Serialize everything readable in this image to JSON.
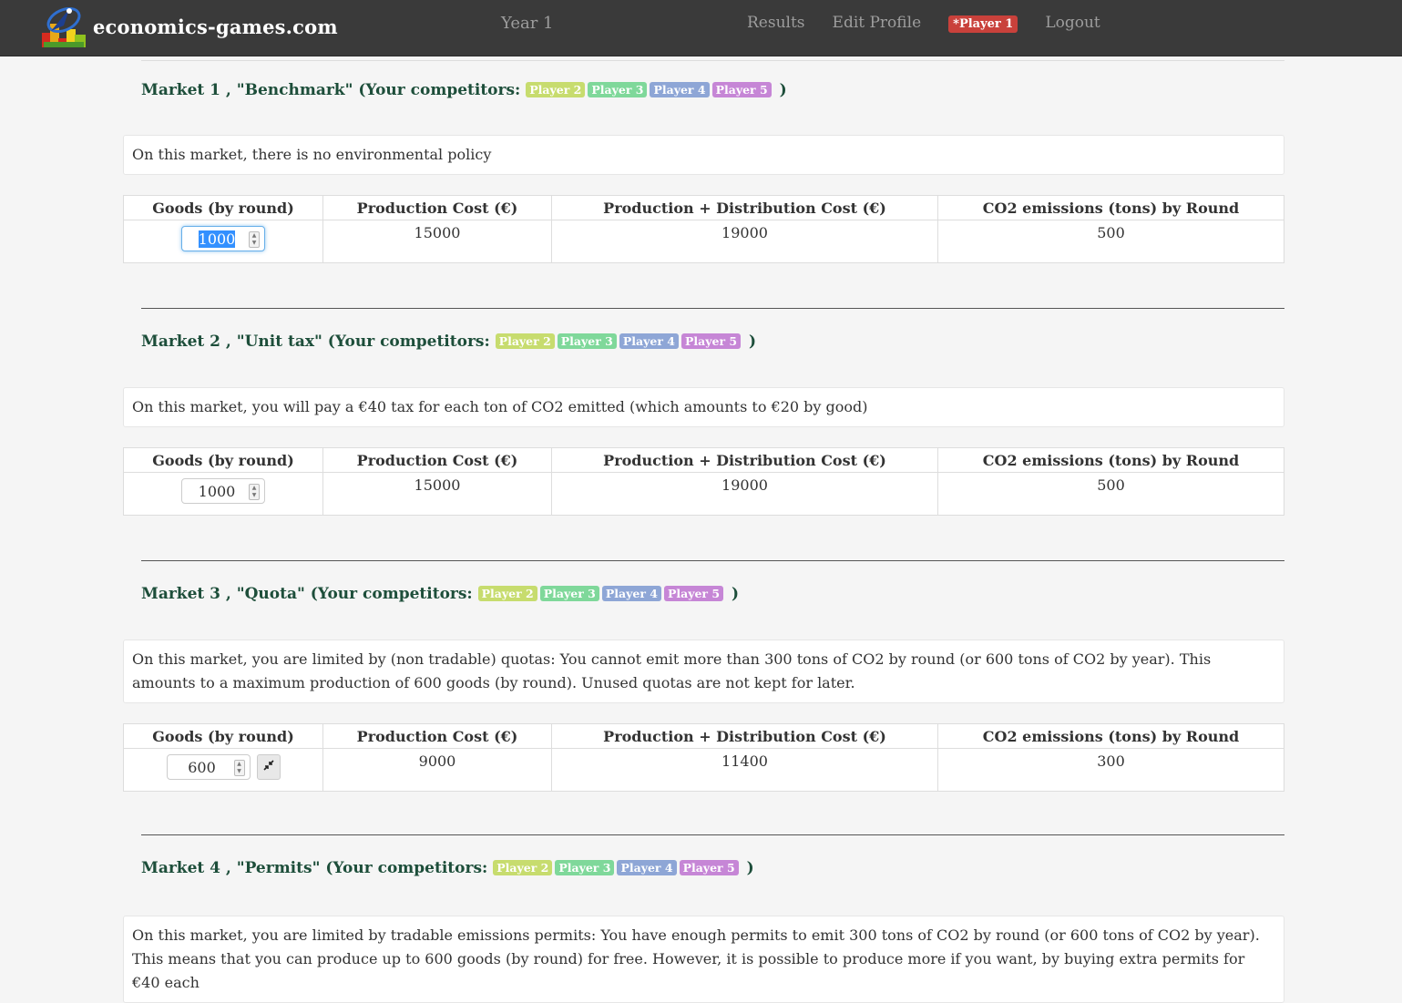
{
  "navbar": {
    "brand": "economics-games.com",
    "year": "Year 1",
    "links": {
      "results": "Results",
      "edit_profile": "Edit Profile",
      "player_badge": "*Player 1",
      "logout": "Logout"
    }
  },
  "table_headers": {
    "goods": "Goods (by round)",
    "production_cost": "Production Cost (€)",
    "production_distribution_cost": "Production + Distribution Cost (€)",
    "co2": "CO2 emissions (tons) by Round"
  },
  "competitor_badges": [
    "Player 2",
    "Player 3",
    "Player 4",
    "Player 5"
  ],
  "markets": [
    {
      "title": "Market 1 , \"Benchmark\" (Your competitors:",
      "close": ")",
      "description": "On this market, there is no environmental policy",
      "goods": "1000",
      "production_cost": "15000",
      "production_distribution_cost": "19000",
      "co2": "500"
    },
    {
      "title": "Market 2 , \"Unit tax\" (Your competitors:",
      "close": ")",
      "description": "On this market, you will pay a €40 tax for each ton of CO2 emitted (which amounts to €20 by good)",
      "goods": "1000",
      "production_cost": "15000",
      "production_distribution_cost": "19000",
      "co2": "500"
    },
    {
      "title": "Market 3 , \"Quota\" (Your competitors:",
      "close": ")",
      "description": "On this market, you are limited by (non tradable) quotas: You cannot emit more than 300 tons of CO2 by round (or 600 tons of CO2 by year). This amounts to a maximum production of 600 goods (by round). Unused quotas are not kept for later.",
      "goods": "600",
      "production_cost": "9000",
      "production_distribution_cost": "11400",
      "co2": "300"
    },
    {
      "title": "Market 4 , \"Permits\" (Your competitors:",
      "close": ")",
      "description": "On this market, you are limited by tradable emissions permits: You have enough permits to emit 300 tons of CO2 by round (or 600 tons of CO2 by year). This means that you can produce up to 600 goods (by round) for free. However, it is possible to produce more if you want, by buying extra permits for €40 each"
    }
  ],
  "colors": {
    "navbar": "#3a3a3a",
    "player_badge": "#c9413b",
    "title": "#1d4e3a",
    "player2": "#c7dc6e",
    "player3": "#7fd89a",
    "player4": "#8ea6d6",
    "player5": "#c686d6"
  }
}
